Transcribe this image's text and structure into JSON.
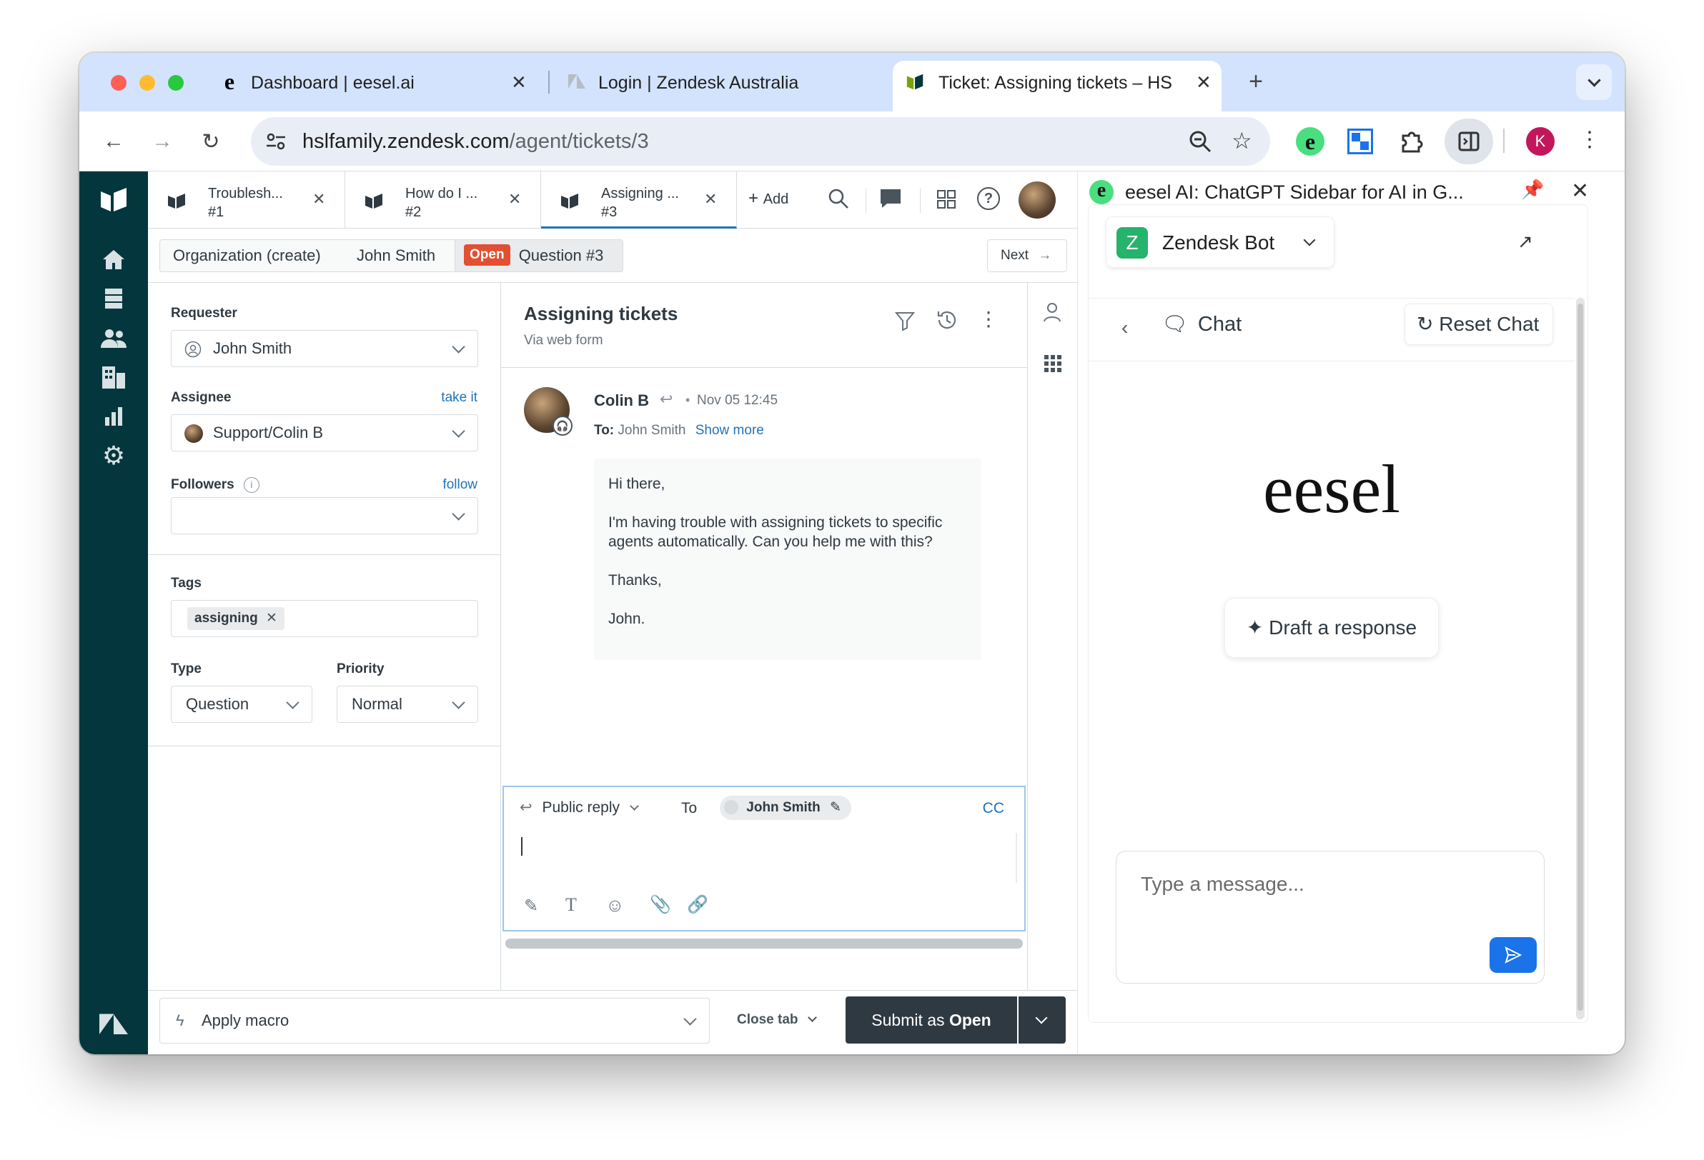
{
  "browser": {
    "tabs": [
      {
        "title": "Dashboard | eesel.ai",
        "favicon": "eesel-logo-icon"
      },
      {
        "title": "Login | Zendesk Australia",
        "favicon": "zendesk-logo-icon"
      },
      {
        "title": "Ticket: Assigning tickets – HS",
        "favicon": "zendesk-support-icon"
      }
    ],
    "url_host": "hslfamily.zendesk.com",
    "url_path": "/agent/tickets/3",
    "profile_initial": "K"
  },
  "zendesk": {
    "tabs": [
      {
        "title": "Troublesh...",
        "num": "#1"
      },
      {
        "title": "How do I ...",
        "num": "#2"
      },
      {
        "title": "Assigning ...",
        "num": "#3"
      }
    ],
    "add_label": "Add",
    "breadcrumbs": {
      "org": "Organization (create)",
      "user": "John Smith",
      "status": "Open",
      "ticket": "Question #3",
      "next": "Next"
    },
    "props": {
      "requester_label": "Requester",
      "requester_value": "John Smith",
      "assignee_label": "Assignee",
      "assignee_action": "take it",
      "assignee_value": "Support/Colin B",
      "followers_label": "Followers",
      "followers_action": "follow",
      "tags_label": "Tags",
      "tag": "assigning",
      "type_label": "Type",
      "type_value": "Question",
      "priority_label": "Priority",
      "priority_value": "Normal"
    },
    "ticket": {
      "subject": "Assigning tickets",
      "via": "Via web form",
      "author": "Colin B",
      "separator": "•",
      "time": "Nov 05 12:45",
      "to_label": "To:",
      "to_value": "John Smith",
      "show_more": "Show more",
      "body": [
        "Hi there,",
        "I'm having trouble with assigning tickets to specific agents automatically. Can you help me with this?",
        "Thanks,",
        "John."
      ]
    },
    "composer": {
      "mode": "Public reply",
      "to_label": "To",
      "recipient": "John Smith",
      "cc": "CC"
    },
    "bottom": {
      "macro": "Apply macro",
      "close_tab": "Close tab",
      "submit_prefix": "Submit as",
      "submit_status": "Open"
    }
  },
  "sidebar": {
    "title": "eesel AI: ChatGPT Sidebar for AI in G...",
    "bot_initial": "Z",
    "bot_name": "Zendesk Bot",
    "chat_label": "Chat",
    "reset_label": "Reset Chat",
    "logo_text": "eesel",
    "draft_label": "Draft a response",
    "input_placeholder": "Type a message..."
  },
  "colors": {
    "nav_bg": "#03363d",
    "status_open": "#e34f32",
    "link": "#1f73b7",
    "submit_bg": "#2f3941",
    "send_button": "#1a73e8",
    "bot_green": "#26b36b"
  }
}
